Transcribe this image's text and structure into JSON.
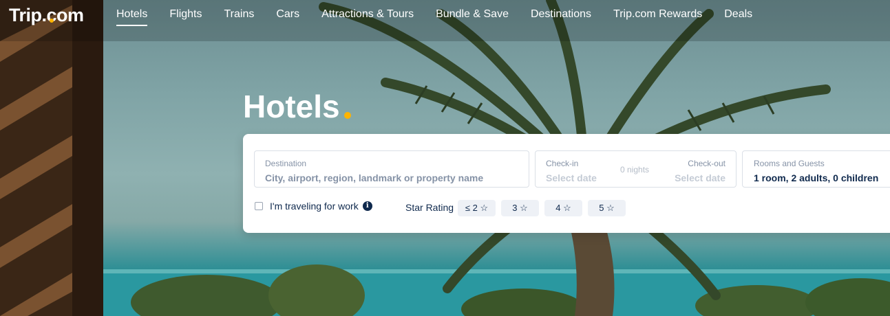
{
  "brand": {
    "logo": "Trip.com",
    "accent": "#ffb400"
  },
  "nav": {
    "items": [
      {
        "label": "Hotels",
        "active": true
      },
      {
        "label": "Flights"
      },
      {
        "label": "Trains"
      },
      {
        "label": "Cars"
      },
      {
        "label": "Attractions & Tours"
      },
      {
        "label": "Bundle & Save"
      },
      {
        "label": "Destinations"
      },
      {
        "label": "Trip.com Rewards"
      },
      {
        "label": "Deals"
      }
    ]
  },
  "hero": {
    "title": "Hotels"
  },
  "search": {
    "destination": {
      "label": "Destination",
      "placeholder": "City, airport, region, landmark or property name"
    },
    "checkin": {
      "label": "Check-in",
      "placeholder": "Select date"
    },
    "nights": "0 nights",
    "checkout": {
      "label": "Check-out",
      "placeholder": "Select date"
    },
    "rooms": {
      "label": "Rooms and Guests",
      "value": "1 room, 2 adults, 0 children"
    },
    "work_label": "I'm traveling for work",
    "info_glyph": "i",
    "star_label": "Star Rating",
    "star_options": [
      "≤ 2 ☆",
      "3 ☆",
      "4 ☆",
      "5 ☆"
    ]
  }
}
